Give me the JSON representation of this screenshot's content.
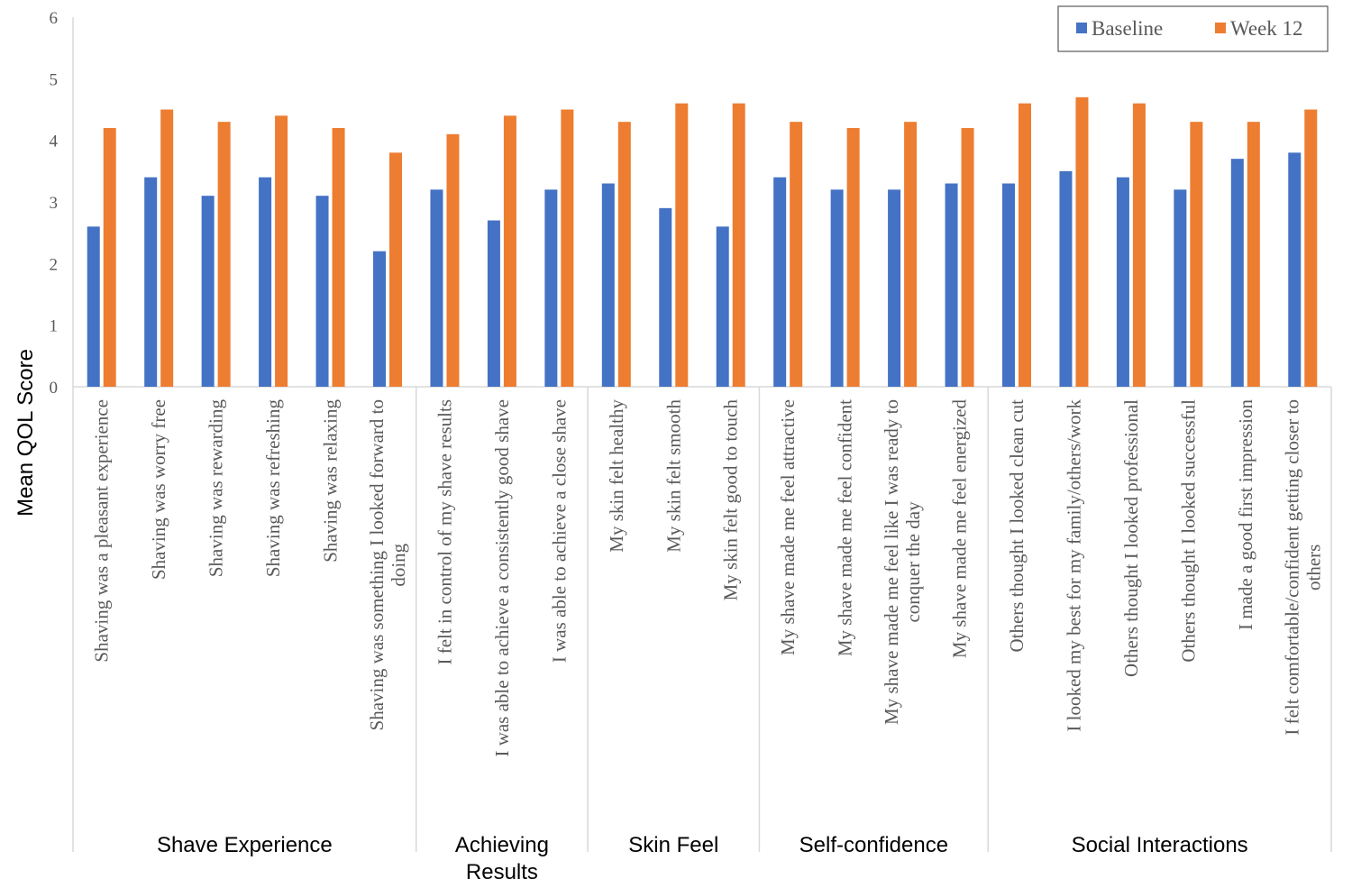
{
  "chart_data": {
    "type": "bar",
    "title": "",
    "xlabel": "",
    "ylabel": "Mean QOL Score",
    "ylim": [
      0,
      6
    ],
    "yticks": [
      0,
      1,
      2,
      3,
      4,
      5,
      6
    ],
    "grid": false,
    "legend_position": "top-right",
    "colors": {
      "Baseline": "#4472C4",
      "Week 12": "#ED7D31"
    },
    "categories": [
      [
        "Shaving was a pleasant experience"
      ],
      [
        "Shaving was worry free"
      ],
      [
        "Shaving was rewarding"
      ],
      [
        "Shaving was refreshing"
      ],
      [
        "Shaving was relaxing"
      ],
      [
        "Shaving was something I looked forward to",
        "doing"
      ],
      [
        "I felt in control of my shave results"
      ],
      [
        "I was able to achieve a consistently good shave"
      ],
      [
        "I was able to achieve a close shave"
      ],
      [
        "My skin felt healthy"
      ],
      [
        "My skin felt smooth"
      ],
      [
        "My skin felt good to touch"
      ],
      [
        "My shave made me feel attractive"
      ],
      [
        "My shave made me feel confident"
      ],
      [
        "My shave made me feel like I was ready to",
        "conquer the day"
      ],
      [
        "My shave made me feel energized"
      ],
      [
        "Others thought I looked clean cut"
      ],
      [
        "I looked my best for my family/others/work"
      ],
      [
        "Others thought I looked professional"
      ],
      [
        "Others thought I looked successful"
      ],
      [
        "I made a good first impression"
      ],
      [
        "I felt comfortable/confident getting closer to",
        "others"
      ]
    ],
    "groups": [
      {
        "name": [
          "Shave Experience"
        ],
        "count": 6
      },
      {
        "name": [
          "Achieving",
          "Results"
        ],
        "count": 3
      },
      {
        "name": [
          "Skin Feel"
        ],
        "count": 3
      },
      {
        "name": [
          "Self-confidence"
        ],
        "count": 4
      },
      {
        "name": [
          "Social Interactions"
        ],
        "count": 6
      }
    ],
    "series": [
      {
        "name": "Baseline",
        "values": [
          2.6,
          3.4,
          3.1,
          3.4,
          3.1,
          2.2,
          3.2,
          2.7,
          3.2,
          3.3,
          2.9,
          2.6,
          3.4,
          3.2,
          3.2,
          3.3,
          3.3,
          3.5,
          3.4,
          3.2,
          3.7,
          3.8
        ]
      },
      {
        "name": "Week 12",
        "values": [
          4.2,
          4.5,
          4.3,
          4.4,
          4.2,
          3.8,
          4.1,
          4.4,
          4.5,
          4.3,
          4.6,
          4.6,
          4.3,
          4.2,
          4.3,
          4.2,
          4.6,
          4.7,
          4.6,
          4.3,
          4.3,
          4.5
        ]
      }
    ]
  }
}
